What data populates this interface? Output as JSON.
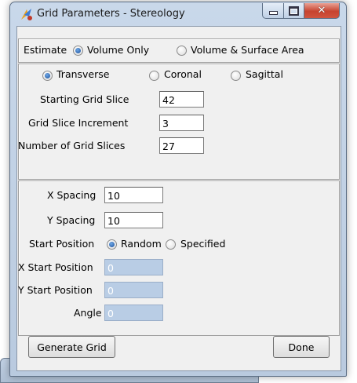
{
  "window": {
    "title": "Grid Parameters - Stereology",
    "icons": {
      "app": "app-icon",
      "minimize": "minimize-icon",
      "maximize": "maximize-icon",
      "close": "close-icon"
    }
  },
  "estimate": {
    "label": "Estimate",
    "options": [
      {
        "label": "Volume Only",
        "selected": true
      },
      {
        "label": "Volume & Surface Area",
        "selected": false
      }
    ]
  },
  "orientation": {
    "options": [
      {
        "label": "Transverse",
        "selected": true
      },
      {
        "label": "Coronal",
        "selected": false
      },
      {
        "label": "Sagittal",
        "selected": false
      }
    ]
  },
  "slices": {
    "starting_label": "Starting Grid Slice",
    "starting_value": "42",
    "increment_label": "Grid Slice Increment",
    "increment_value": "3",
    "count_label": "Number of Grid Slices",
    "count_value": "27"
  },
  "spacing": {
    "x_label": "X Spacing",
    "x_value": "10",
    "y_label": "Y Spacing",
    "y_value": "10",
    "start_label": "Start Position",
    "start_options": [
      {
        "label": "Random",
        "selected": true
      },
      {
        "label": "Specified",
        "selected": false
      }
    ],
    "x_start_label": "X Start Position",
    "x_start_value": "0",
    "y_start_label": "Y Start Position",
    "y_start_value": "0",
    "angle_label": "Angle",
    "angle_value": "0"
  },
  "buttons": {
    "generate": "Generate Grid",
    "done": "Done"
  },
  "colors": {
    "disabled_field": "#b9cde5",
    "radio_selected": "#1b4f9a",
    "close_button": "#c7432f"
  }
}
